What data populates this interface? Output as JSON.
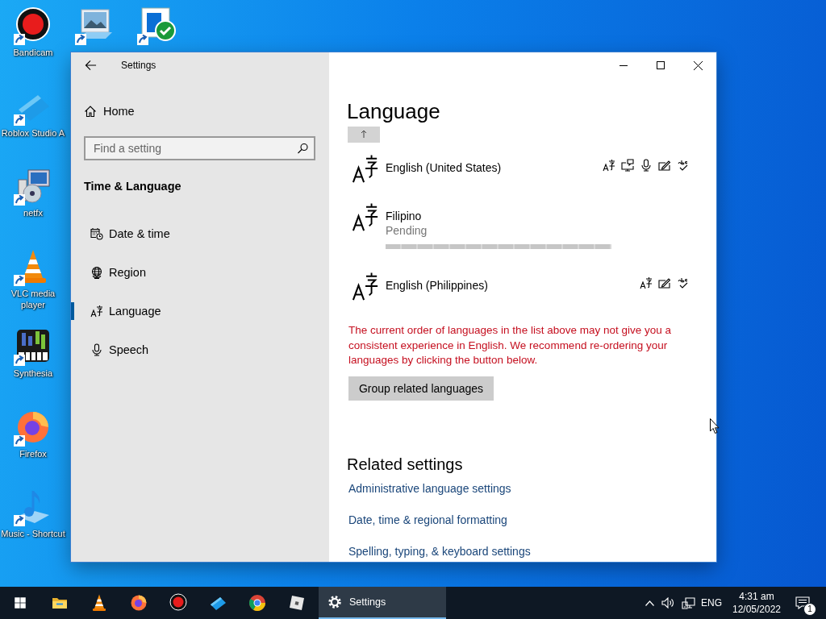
{
  "desktop_icons": [
    {
      "kind": "bandicam",
      "label": "Bandicam"
    },
    {
      "kind": "pictures"
    },
    {
      "kind": "default-apps"
    },
    {
      "kind": "roblox-studio",
      "label": "Roblox Studio A"
    },
    {
      "kind": "netfx",
      "label": "netfx"
    },
    {
      "kind": "vlc",
      "label": "VLC media player"
    },
    {
      "kind": "synthesia",
      "label": "Synthesia"
    },
    {
      "kind": "firefox",
      "label": "Firefox"
    },
    {
      "kind": "music",
      "label": "Music - Shortcut"
    }
  ],
  "settings": {
    "title": "Settings",
    "home": "Home",
    "search_placeholder": "Find a setting",
    "section": "Time & Language",
    "nav": [
      {
        "kind": "date-time",
        "label": "Date & time",
        "selected": false
      },
      {
        "kind": "region",
        "label": "Region",
        "selected": false
      },
      {
        "kind": "language",
        "label": "Language",
        "selected": true
      },
      {
        "kind": "speech",
        "label": "Speech",
        "selected": false
      }
    ],
    "page_title": "Language",
    "languages": [
      {
        "name": "English (United States)",
        "features": [
          {
            "kind": "display"
          },
          {
            "kind": "text-to-speech"
          },
          {
            "kind": "speech"
          },
          {
            "kind": "handwriting"
          },
          {
            "kind": "spelling"
          }
        ]
      },
      {
        "name": "Filipino",
        "status": "Pending",
        "level": 1
      },
      {
        "name": "English (Philippines)",
        "features": [
          {
            "kind": "display"
          },
          {
            "kind": "handwriting"
          },
          {
            "kind": "spelling"
          }
        ]
      }
    ],
    "warning": "The current order of languages in the list above may not give you a consistent experience in English. We recommend re-ordering your languages by clicking the button below.",
    "group_button": "Group related languages",
    "related_title": "Related settings",
    "related_links": [
      "Administrative language settings",
      "Date, time & regional formatting",
      "Spelling, typing, & keyboard settings"
    ]
  },
  "taskbar": {
    "pinned": [
      {
        "kind": "start"
      },
      {
        "kind": "file-explorer"
      },
      {
        "kind": "vlc"
      },
      {
        "kind": "firefox"
      },
      {
        "kind": "bandicam"
      },
      {
        "kind": "roblox-studio"
      },
      {
        "kind": "chrome"
      },
      {
        "kind": "roblox"
      }
    ],
    "active_app": {
      "kind": "settings",
      "label": "Settings"
    },
    "tray": {
      "language": "ENG",
      "time": "4:31 am",
      "date": "12/05/2022",
      "notifications": "1"
    }
  }
}
